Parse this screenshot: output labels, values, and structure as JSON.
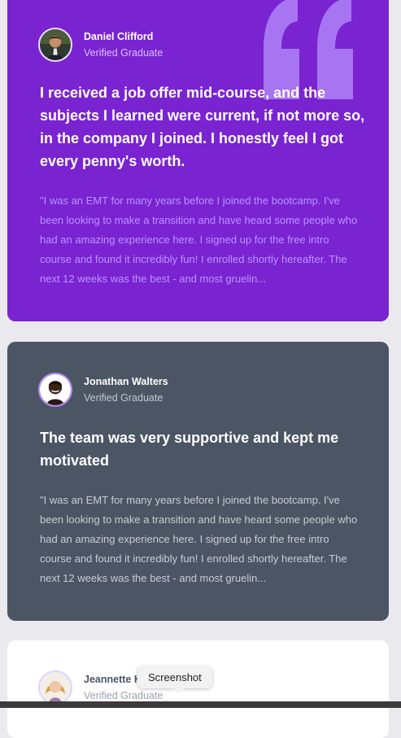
{
  "testimonials": [
    {
      "name": "Daniel Clifford",
      "role": "Verified Graduate",
      "headline": "I received a job offer mid-course, and the subjects I learned were current, if not more so, in the company I joined. I honestly feel I got every penny's worth.",
      "excerpt": "\"I was an EMT for many years before I joined the bootcamp. I've been looking to make a transition and have heard some people who had an amazing experience here. I signed up for the free intro course and found it incredibly fun! I enrolled shortly hereafter. The next 12 weeks was the best - and most gruelin...",
      "background": "#7a23d1",
      "accent_text": "#b894ff",
      "avatar_icon": "avatar-daniel"
    },
    {
      "name": "Jonathan Walters",
      "role": "Verified Graduate",
      "headline": "The team was very supportive and kept me motivated",
      "excerpt": "\"I was an EMT for many years before I joined the bootcamp. I've been looking to make a transition and have heard some people who had an amazing experience here. I signed up for the free intro course and found it incredibly fun! I enrolled shortly hereafter. The next 12 weeks was the best - and most gruelin...",
      "background": "#4b5564",
      "accent_text": "#c9ccd3",
      "avatar_icon": "avatar-jonathan"
    },
    {
      "name": "Jeannette H",
      "role": "Verified Graduate",
      "background": "#ffffff",
      "avatar_icon": "avatar-jeannette"
    }
  ],
  "tooltip": {
    "label": "Screenshot"
  },
  "decorations": {
    "quote_icon": "quote-icon",
    "quote_color": "#a775f1"
  }
}
